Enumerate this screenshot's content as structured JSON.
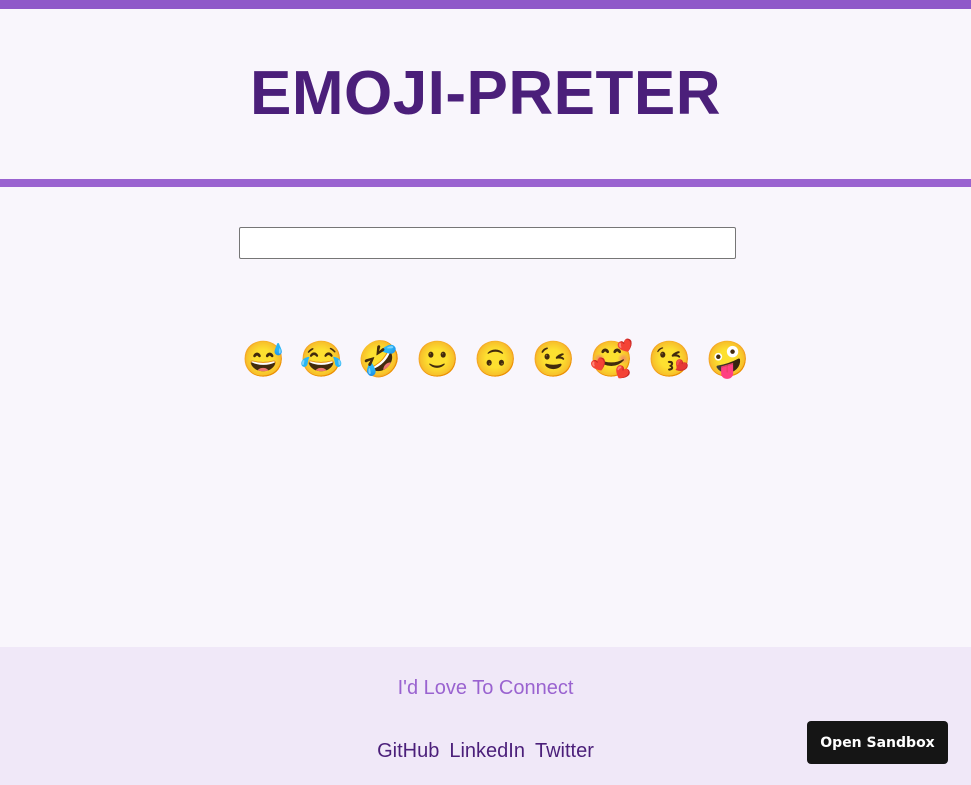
{
  "header": {
    "title": "EMOJI-PRETER"
  },
  "search": {
    "value": "",
    "placeholder": ""
  },
  "emojis": [
    {
      "char": "😅",
      "name": "grinning-face-with-sweat"
    },
    {
      "char": "😂",
      "name": "face-with-tears-of-joy"
    },
    {
      "char": "🤣",
      "name": "rolling-on-the-floor-laughing"
    },
    {
      "char": "🙂",
      "name": "slightly-smiling-face"
    },
    {
      "char": "🙃",
      "name": "upside-down-face"
    },
    {
      "char": "😉",
      "name": "winking-face"
    },
    {
      "char": "🥰",
      "name": "smiling-face-with-hearts"
    },
    {
      "char": "😘",
      "name": "face-blowing-a-kiss"
    },
    {
      "char": "🤪",
      "name": "zany-face"
    }
  ],
  "footer": {
    "heading": "I'd Love To Connect",
    "links": [
      "GitHub",
      "LinkedIn",
      "Twitter"
    ]
  },
  "sandbox_button": {
    "label": "Open Sandbox"
  },
  "colors": {
    "accent": "#9a63d0",
    "title": "#4b1f7a",
    "background": "#f9f6fc",
    "footer_background": "#f0e8f8"
  }
}
